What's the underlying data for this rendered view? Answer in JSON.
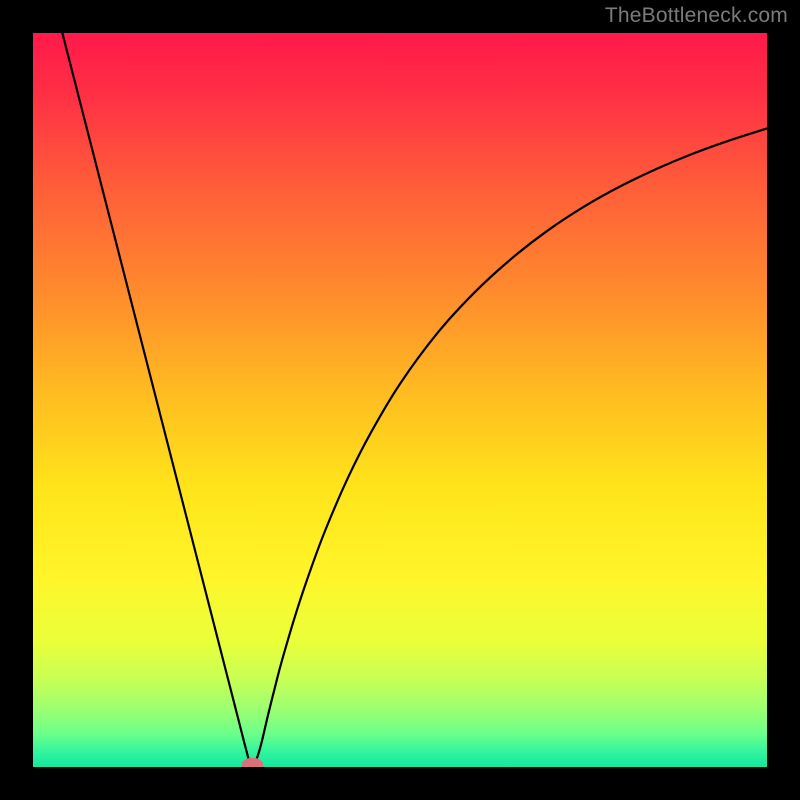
{
  "watermark": "TheBottleneck.com",
  "colors": {
    "frame": "#000000",
    "watermark": "#7b7b7b",
    "curve": "#000000",
    "marker_fill": "#d9707a",
    "gradient_stops": [
      {
        "offset": 0.0,
        "color": "#ff1a4a"
      },
      {
        "offset": 0.08,
        "color": "#ff2e45"
      },
      {
        "offset": 0.2,
        "color": "#ff5a3a"
      },
      {
        "offset": 0.35,
        "color": "#ff8a2d"
      },
      {
        "offset": 0.5,
        "color": "#ffbf20"
      },
      {
        "offset": 0.62,
        "color": "#ffe41a"
      },
      {
        "offset": 0.74,
        "color": "#fff52a"
      },
      {
        "offset": 0.83,
        "color": "#e9ff3a"
      },
      {
        "offset": 0.88,
        "color": "#c8ff55"
      },
      {
        "offset": 0.92,
        "color": "#9dff70"
      },
      {
        "offset": 0.955,
        "color": "#6bff8a"
      },
      {
        "offset": 0.978,
        "color": "#35f59c"
      },
      {
        "offset": 1.0,
        "color": "#12e8a0"
      }
    ]
  },
  "chart_data": {
    "type": "line",
    "title": "",
    "xlabel": "",
    "ylabel": "",
    "xlim": [
      0,
      100
    ],
    "ylim": [
      0,
      100
    ],
    "grid": false,
    "series": [
      {
        "name": "bottleneck-curve",
        "x": [
          4,
          6,
          8,
          10,
          12,
          14,
          16,
          18,
          20,
          22,
          24,
          26,
          27,
          28,
          29,
          29.6,
          30.2,
          31,
          32,
          33,
          34,
          36,
          38,
          40,
          43,
          46,
          50,
          55,
          60,
          65,
          70,
          75,
          80,
          85,
          90,
          95,
          100
        ],
        "y": [
          100,
          92.2,
          84.4,
          76.6,
          68.8,
          61.0,
          53.2,
          45.4,
          37.6,
          29.8,
          22.0,
          14.2,
          10.3,
          6.4,
          2.5,
          0.5,
          0.5,
          2.8,
          7.0,
          11.0,
          14.8,
          21.5,
          27.4,
          32.7,
          39.6,
          45.5,
          52.2,
          59.0,
          64.5,
          69.1,
          73.0,
          76.3,
          79.1,
          81.5,
          83.6,
          85.4,
          87.0
        ]
      }
    ],
    "marker": {
      "x": 29.9,
      "y": 0.3,
      "rx": 1.4,
      "ry": 0.9
    }
  }
}
